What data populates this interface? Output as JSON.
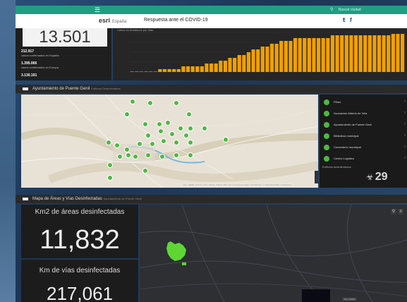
{
  "topbar": {
    "search_placeholder": "Buscar ciudad"
  },
  "header": {
    "brand": "esri",
    "brand_sub": "España",
    "title": "Respuesta ante el COVID-19"
  },
  "cases": {
    "big_number": "13.501",
    "stats": [
      {
        "value": "212.917",
        "label": "casos confirmados en España"
      },
      {
        "value": "1.395.066",
        "label": "casos confirmados en Europa"
      },
      {
        "value": "3.130.191",
        "label": ""
      }
    ]
  },
  "chart": {
    "title": "Casos en Andalucía por días",
    "bar_color": "#f0a000"
  },
  "chart_data": {
    "type": "bar",
    "title": "Casos en Andalucía por días",
    "values": [
      0,
      0,
      0,
      0,
      0,
      0,
      1,
      1,
      1,
      1,
      1,
      2,
      2,
      2,
      2,
      2,
      3,
      3,
      3,
      4,
      4,
      5,
      5,
      6,
      6,
      7,
      8,
      8,
      9,
      9,
      10,
      10,
      11,
      11,
      11,
      12,
      12,
      12,
      12,
      12,
      12,
      12,
      12,
      13,
      13,
      13,
      13,
      13,
      13,
      13,
      13,
      13,
      13,
      13,
      13,
      13,
      13.5,
      13.5,
      13.5
    ],
    "ylim": [
      0,
      14
    ]
  },
  "section1": {
    "title": "Ayuntamiento de Puente Genil",
    "subtitle": "Edificios Desinfectados"
  },
  "map1": {
    "attribution": "Esri, HERE, Garmin, FAO, NOAA, USGS, EPA | Esri Community Maps Contributors, © OpenStreetMap contributors",
    "labels": [
      "Puente Genil",
      "Urbanización Cerro de la Plata",
      "Estación de Puente Genil"
    ],
    "marker_color": "#4fb845"
  },
  "list": {
    "items": [
      "Piñeo",
      "Asociación Alberto de Vela",
      "Ayuntamiento de Puente Genil",
      "Biblioteca municipal",
      "Cementerio municipal",
      "Centro Logístico"
    ]
  },
  "disinfected": {
    "label": "Edificios desinfectados",
    "value": "29"
  },
  "section2": {
    "title": "Mapa de Áreas y Vías Desinfectadas",
    "subtitle": "Ayuntamiento de Puente Genil"
  },
  "kpi": {
    "area_label": "Km2 de áreas desinfectadas",
    "area_value": "11,832",
    "roads_label": "Km de vías desinfectadas",
    "roads_value": "217,061"
  },
  "map2": {
    "attribution": "Esri, HERE"
  }
}
